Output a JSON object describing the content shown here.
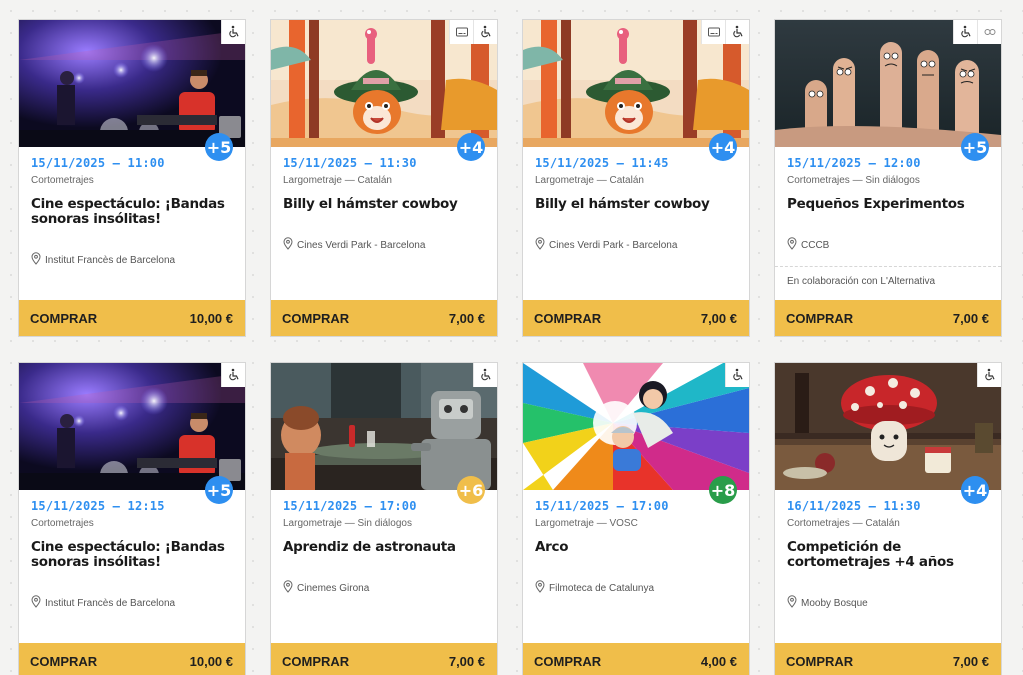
{
  "buy_label": "COMPRAR",
  "colors": {
    "buy": "#f0be4a",
    "date": "#2e8ff0",
    "age_blue": "#2e8ff0",
    "age_yellow": "#f0be4a",
    "age_green": "#2a9d4a"
  },
  "events": [
    {
      "date": "15/11/2025 — 11:00",
      "category": "Cortometrajes",
      "title": "Cine espectáculo: ¡Bandas sonoras insólitas!",
      "venue": "Institut Francès de Barcelona",
      "price": "10,00 €",
      "age": "+5",
      "age_color": "blue",
      "accessibility_icons": [
        "wheelchair-icon"
      ],
      "image": "concert"
    },
    {
      "date": "15/11/2025 — 11:30",
      "category": "Largometraje — Catalán",
      "title": "Billy el hámster cowboy",
      "venue": "Cines Verdi Park - Barcelona",
      "price": "7,00 €",
      "age": "+4",
      "age_color": "blue",
      "accessibility_icons": [
        "subtitles-icon",
        "wheelchair-icon"
      ],
      "image": "hamster"
    },
    {
      "date": "15/11/2025 — 11:45",
      "category": "Largometraje — Catalán",
      "title": "Billy el hámster cowboy",
      "venue": "Cines Verdi Park - Barcelona",
      "price": "7,00 €",
      "age": "+4",
      "age_color": "blue",
      "accessibility_icons": [
        "subtitles-icon",
        "wheelchair-icon"
      ],
      "image": "hamster"
    },
    {
      "date": "15/11/2025 — 12:00",
      "category": "Cortometrajes — Sin diálogos",
      "title": "Pequeños Experimentos",
      "venue": "CCCB",
      "note": "En colaboración con L'Alternativa",
      "price": "7,00 €",
      "age": "+5",
      "age_color": "blue",
      "accessibility_icons": [
        "wheelchair-icon",
        "no-dialogue-icon"
      ],
      "image": "fingers"
    },
    {
      "date": "15/11/2025 — 12:15",
      "category": "Cortometrajes",
      "title": "Cine espectáculo: ¡Bandas sonoras insólitas!",
      "venue": "Institut Francès de Barcelona",
      "price": "10,00 €",
      "age": "+5",
      "age_color": "blue",
      "accessibility_icons": [
        "wheelchair-icon"
      ],
      "image": "concert"
    },
    {
      "date": "15/11/2025 — 17:00",
      "category": "Largometraje — Sin diálogos",
      "title": "Aprendiz de astronauta",
      "venue": "Cinemes Girona",
      "price": "7,00 €",
      "age": "+6",
      "age_color": "yellow",
      "accessibility_icons": [
        "wheelchair-icon"
      ],
      "image": "robot"
    },
    {
      "date": "15/11/2025 — 17:00",
      "category": "Largometraje — VOSC",
      "title": "Arco",
      "venue": "Filmoteca de Catalunya",
      "price": "4,00 €",
      "age": "+8",
      "age_color": "green",
      "accessibility_icons": [
        "wheelchair-icon"
      ],
      "image": "rainbow"
    },
    {
      "date": "16/11/2025 — 11:30",
      "category": "Cortometrajes — Catalán",
      "title": "Competición de cortometrajes +4 años",
      "venue": "Mooby Bosque",
      "price": "7,00 €",
      "age": "+4",
      "age_color": "blue",
      "accessibility_icons": [
        "wheelchair-icon"
      ],
      "image": "mushroom"
    }
  ]
}
